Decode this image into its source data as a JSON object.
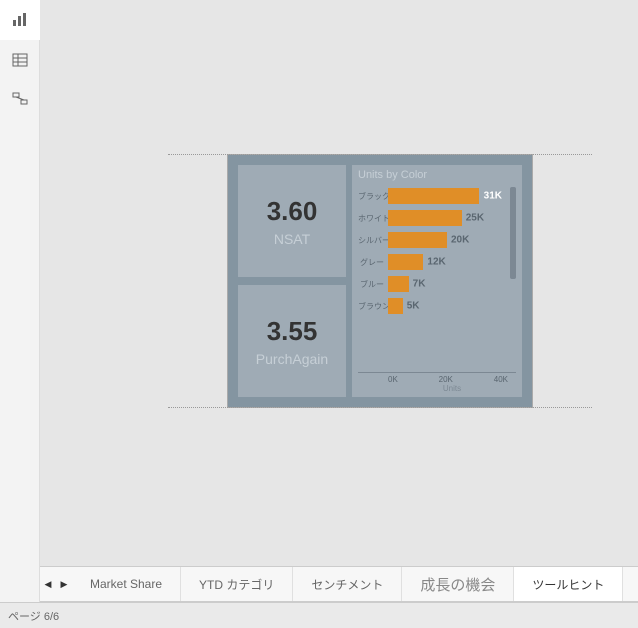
{
  "sidebar": {
    "items": [
      "report-view",
      "data-view",
      "model-view"
    ]
  },
  "cards": [
    {
      "value": "3.60",
      "label": "NSAT"
    },
    {
      "value": "3.55",
      "label": "PurchAgain"
    }
  ],
  "chart": {
    "title": "Units by Color",
    "xlabel": "Units",
    "ticks": [
      "0K",
      "20K",
      "40K"
    ]
  },
  "chart_data": {
    "type": "bar",
    "title": "Units by Color",
    "xlabel": "Units",
    "ylabel": "",
    "xlim": [
      0,
      40000
    ],
    "categories": [
      "ブラック",
      "ホワイト",
      "シルバー",
      "グレー",
      "ブルー",
      "ブラウン"
    ],
    "values": [
      31000,
      25000,
      20000,
      12000,
      7000,
      5000
    ],
    "labels": [
      "31K",
      "25K",
      "20K",
      "12K",
      "7K",
      "5K"
    ]
  },
  "tabs": {
    "items": [
      "Market Share",
      "YTD カテゴリ",
      "センチメント",
      "成長の機会",
      "ツールヒント"
    ],
    "active_index": 4
  },
  "status": {
    "text": "ページ 6/6"
  }
}
